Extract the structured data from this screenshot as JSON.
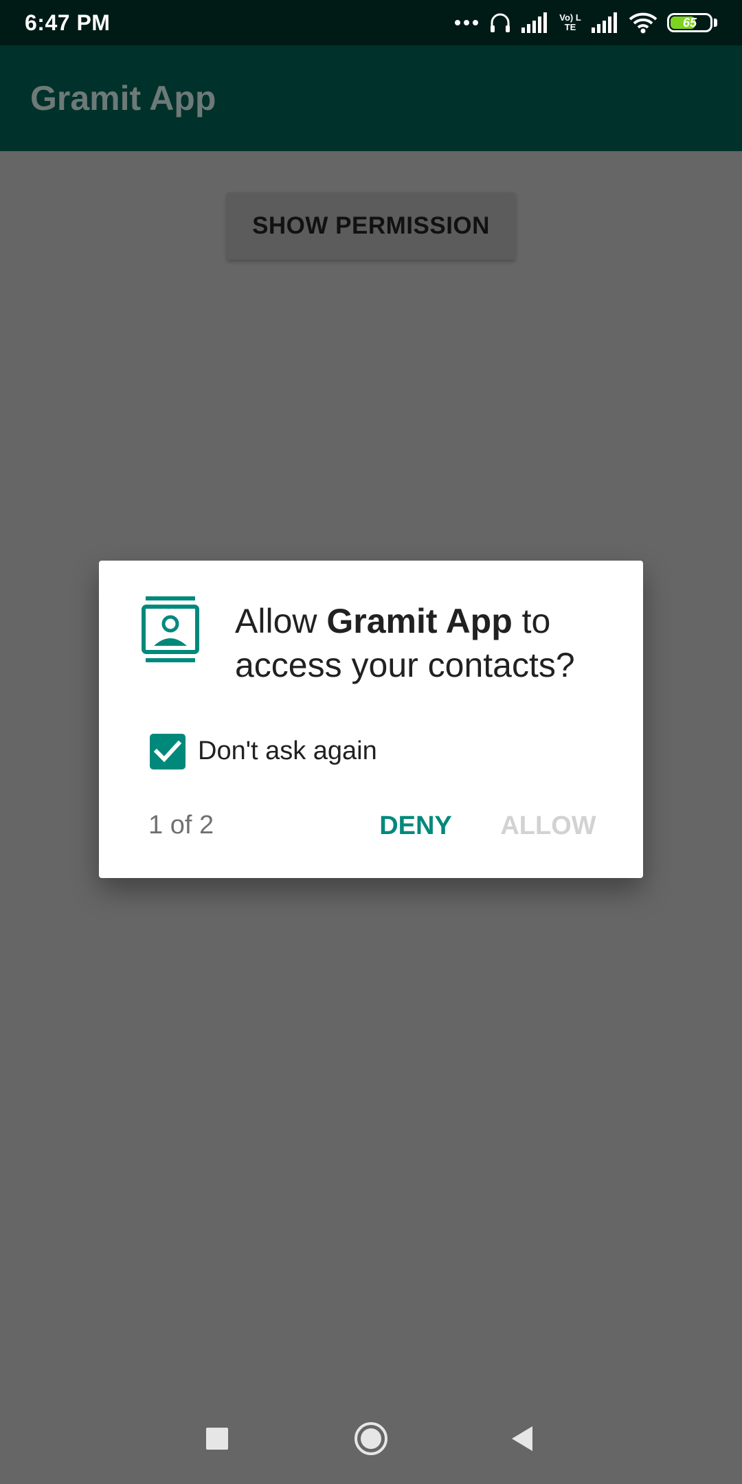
{
  "status_bar": {
    "time": "6:47 PM",
    "battery_level": "65",
    "icons": [
      "more-dots-icon",
      "headphones-icon",
      "signal-icon",
      "volte-icon",
      "signal-icon",
      "wifi-icon",
      "battery-icon"
    ],
    "volte_label": "Vo) LTE"
  },
  "app_bar": {
    "title": "Gramit App"
  },
  "main": {
    "show_permission_label": "SHOW PERMISSION"
  },
  "dialog": {
    "icon": "contacts-icon",
    "title_prefix": "Allow ",
    "title_app": "Gramit App",
    "title_suffix": " to access your contacts?",
    "checkbox_checked": true,
    "checkbox_label": "Don't ask again",
    "page_indicator": "1 of 2",
    "deny_label": "DENY",
    "allow_label": "ALLOW",
    "accent_color": "#00897b"
  },
  "nav_bar": {
    "buttons": [
      "recents-icon",
      "home-icon",
      "back-icon"
    ]
  }
}
